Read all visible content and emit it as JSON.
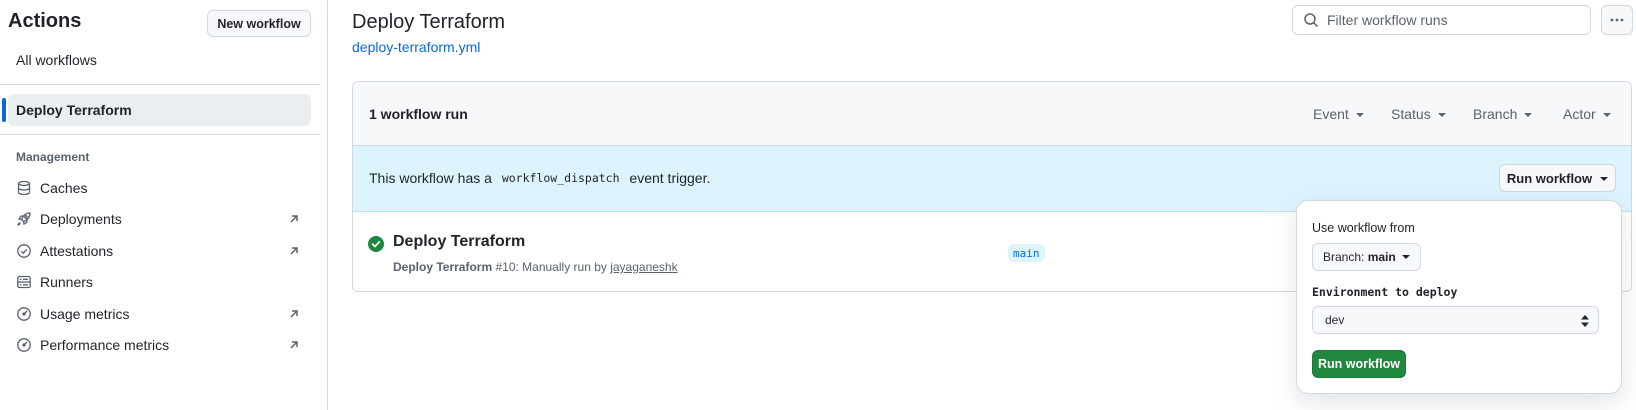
{
  "sidebar": {
    "title": "Actions",
    "new_workflow_label": "New workflow",
    "all_workflows_label": "All workflows",
    "selected_workflow": "Deploy Terraform",
    "management_label": "Management",
    "management_items": [
      {
        "label": "Caches",
        "icon": "database-icon",
        "external": false
      },
      {
        "label": "Deployments",
        "icon": "rocket-icon",
        "external": true
      },
      {
        "label": "Attestations",
        "icon": "verified-check-icon",
        "external": true
      },
      {
        "label": "Runners",
        "icon": "server-icon",
        "external": false
      },
      {
        "label": "Usage metrics",
        "icon": "meter-icon",
        "external": true
      },
      {
        "label": "Performance metrics",
        "icon": "meter-icon",
        "external": true
      }
    ]
  },
  "main": {
    "title": "Deploy Terraform",
    "file_link": "deploy-terraform.yml",
    "filter_placeholder": "Filter workflow runs",
    "runs_count": "1 workflow run",
    "filters": [
      "Event",
      "Status",
      "Branch",
      "Actor"
    ],
    "dispatch": {
      "prefix": "This workflow has a ",
      "code": "workflow_dispatch",
      "suffix": " event trigger.",
      "button_label": "Run workflow"
    },
    "run": {
      "name": "Deploy Terraform",
      "status": "success",
      "sub_workflow": "Deploy Terraform",
      "sub_detail": " #10: Manually run by ",
      "actor": "jayaganeshk",
      "branch": "main"
    }
  },
  "popover": {
    "use_from_label": "Use workflow from",
    "branch_prefix": "Branch: ",
    "branch_value": "main",
    "env_label": "Environment to deploy",
    "env_value": "dev",
    "submit_label": "Run workflow"
  },
  "colors": {
    "accent": "#0969da",
    "success": "#1f883d",
    "info_bg": "#ddf4ff",
    "selected_bg": "#ebeef1"
  }
}
